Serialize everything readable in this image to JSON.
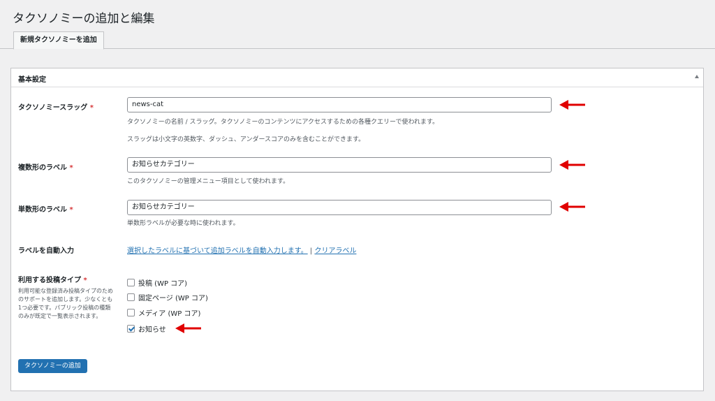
{
  "page": {
    "title": "タクソノミーの追加と編集",
    "tab_label": "新規タクソノミーを追加"
  },
  "panel": {
    "title": "基本設定"
  },
  "fields": {
    "slug": {
      "label": "タクソノミースラッグ",
      "required": "*",
      "value": "news-cat",
      "desc1": "タクソノミーの名前 / スラッグ。タクソノミーのコンテンツにアクセスするための各種クエリーで使われます。",
      "desc2": "スラッグは小文字の英数字、ダッシュ、アンダースコアのみを含むことができます。"
    },
    "plural": {
      "label": "複数形のラベル",
      "required": "*",
      "value": "お知らせカテゴリー",
      "desc": "このタクソノミーの管理メニュー項目として使われます。"
    },
    "singular": {
      "label": "単数形のラベル",
      "required": "*",
      "value": "お知らせカテゴリー",
      "desc": "単数形ラベルが必要な時に使われます。"
    },
    "autofill": {
      "label": "ラベルを自動入力",
      "link1": "選択したラベルに基づいて追加ラベルを自動入力します。",
      "separator": "|",
      "link2": "クリアラベル"
    },
    "post_types": {
      "label": "利用する投稿タイプ",
      "required": "*",
      "desc": "利用可能な登録済み投稿タイプのためのサポートを追加します。少なくとも1つ必要です。パブリック投稿の種類のみが既定で一覧表示されます。",
      "options": [
        {
          "label": "投稿 (WP コア)",
          "checked": false
        },
        {
          "label": "固定ページ (WP コア)",
          "checked": false
        },
        {
          "label": "メディア (WP コア)",
          "checked": false
        },
        {
          "label": "お知らせ",
          "checked": true
        }
      ]
    }
  },
  "submit_label": "タクソノミーの追加",
  "colors": {
    "accent": "#2271b1",
    "required": "#d63638",
    "arrow": "#e00000",
    "background": "#f0f0f1"
  },
  "icons": {
    "panel_toggle": "triangle-up-icon",
    "annotation": "red-arrow-left-icon"
  }
}
